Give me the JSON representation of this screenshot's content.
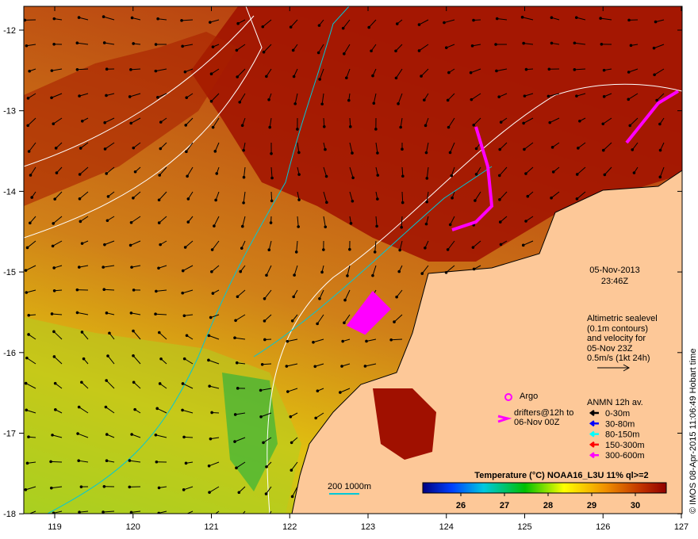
{
  "map": {
    "date": "05-Nov-2013",
    "time": "23:46Z",
    "lon_ticks": [
      "119",
      "120",
      "121",
      "122",
      "123",
      "124",
      "125",
      "126",
      "127"
    ],
    "lat_ticks": [
      "-12",
      "-13",
      "-14",
      "-15",
      "-16",
      "-17",
      "-18"
    ],
    "altimetry_note": [
      "Altimetric sealevel",
      "(0.1m contours)",
      "and velocity for",
      "05-Nov 23Z",
      "0.5m/s (1kt 24h)"
    ],
    "argo_label": "Argo",
    "drifters_label": [
      "drifters@12h to",
      "06-Nov 00Z"
    ],
    "anmn_title": "ANMN 12h av.",
    "anmn_legend": [
      {
        "label": "0-30m",
        "color": "#000000"
      },
      {
        "label": "30-80m",
        "color": "#0000ff"
      },
      {
        "label": "80-150m",
        "color": "#00ffff"
      },
      {
        "label": "150-300m",
        "color": "#ff0000"
      },
      {
        "label": "300-600m",
        "color": "#ff00ff"
      }
    ],
    "bathy_label": "200  1000m",
    "colorbar_title": "Temperature (°C) NOAA16_L3U 11% ql>=2",
    "colorbar_ticks": [
      "26",
      "27",
      "28",
      "29",
      "30"
    ],
    "copyright": "© IMOS 08-Apr-2015 11:06:49 Hobart time",
    "colors": {
      "land": "#fdc898",
      "sea_warm": "#a81800",
      "sea_mid": "#d07010",
      "argo": "#ff00ff",
      "contour": "#ffffff",
      "bathy": "#00c8d8"
    }
  }
}
